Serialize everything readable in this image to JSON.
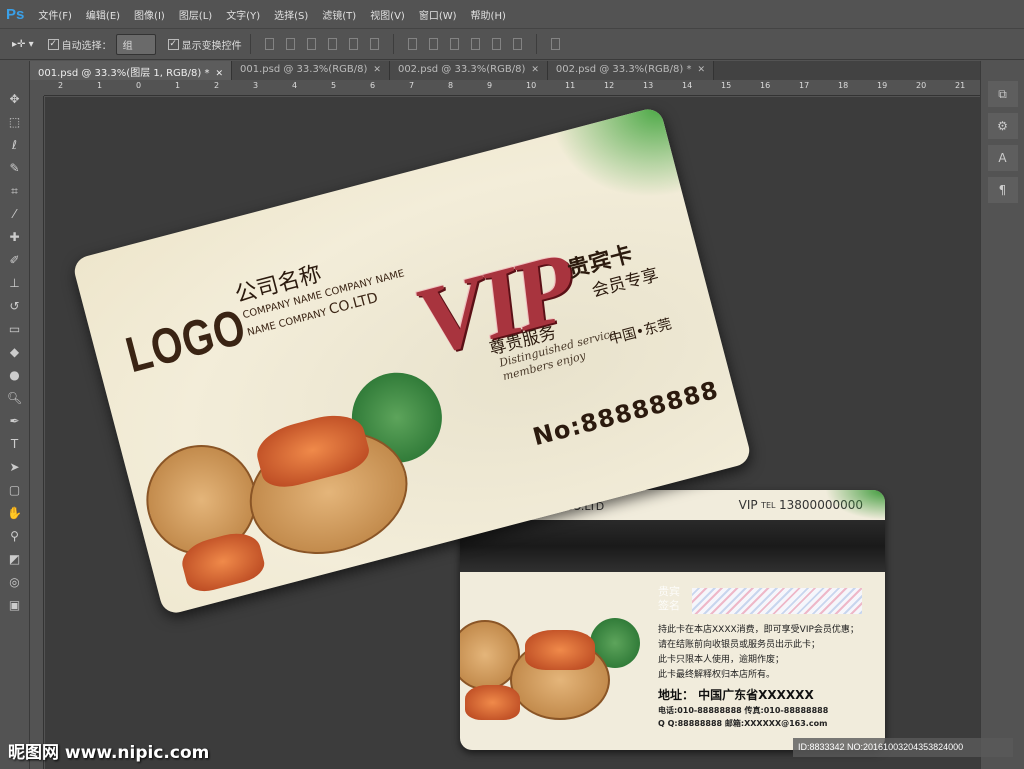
{
  "app": {
    "logo": "Ps"
  },
  "menu": [
    "文件(F)",
    "编辑(E)",
    "图像(I)",
    "图层(L)",
    "文字(Y)",
    "选择(S)",
    "滤镜(T)",
    "视图(V)",
    "窗口(W)",
    "帮助(H)"
  ],
  "options": {
    "auto_select_label": "自动选择：",
    "auto_select_value": "组",
    "show_transform_label": "显示变换控件"
  },
  "tabs": [
    {
      "label": "001.psd @ 33.3%(图层 1, RGB/8) *",
      "active": true
    },
    {
      "label": "001.psd @ 33.3%(RGB/8)",
      "active": false
    },
    {
      "label": "002.psd @ 33.3%(RGB/8)",
      "active": false
    },
    {
      "label": "002.psd @ 33.3%(RGB/8) *",
      "active": false
    }
  ],
  "ruler_ticks": [
    "2",
    "1",
    "0",
    "1",
    "2",
    "3",
    "4",
    "5",
    "6",
    "7",
    "8",
    "9",
    "10",
    "11",
    "12",
    "13",
    "14",
    "15",
    "16",
    "17",
    "18",
    "19",
    "20",
    "21"
  ],
  "front_card": {
    "logo": "LOGO",
    "company_cn": "公司名称",
    "company_en_1": "COMPANY NAME COMPANY NAME",
    "company_en_2": "NAME COMPANY",
    "company_en_3": "CO.LTD",
    "vip": "VIP",
    "guest_card": "贵宾卡",
    "member_only": "会员专享",
    "noble_service": "尊贵服务",
    "script_1": "Distinguished service",
    "script_2": "members enjoy",
    "city": "中国•东莞",
    "number": "No:88888888"
  },
  "back_card": {
    "company": "CO.LTD",
    "vip": "VIP",
    "tel_label": "TEL",
    "tel": "13800000000",
    "signature_label_1": "贵宾",
    "signature_label_2": "签名",
    "rules": [
      "持此卡在本店XXXX消费，即可享受VIP会员优惠；",
      "请在结账前向收银员或服务员出示此卡；",
      "此卡只限本人使用，逾期作废；",
      "此卡最终解释权归本店所有。"
    ],
    "address": "地址：  中国广东省XXXXXX",
    "phone_fax": "电话:010-88888888  传真:010-88888888",
    "qq_email": "Q Q:88888888  邮箱:XXXXXX@163.com"
  },
  "watermark": "昵图网 www.nipic.com",
  "id_badge": "ID:8833342 NO:20161003204353824000"
}
